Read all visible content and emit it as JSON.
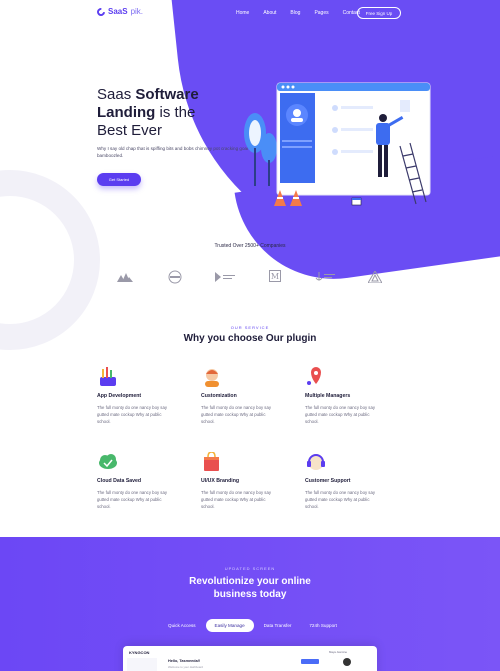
{
  "brand": {
    "name_bold": "SaaS",
    "name_light": "pik."
  },
  "nav": {
    "items": [
      "Home",
      "About",
      "Blog",
      "Pages",
      "Contact"
    ],
    "signup_label": "Free Sign Up"
  },
  "hero": {
    "title_1": "Saas ",
    "title_bold_1": "Software",
    "title_bold_2": "Landing",
    "title_2": " is the",
    "title_3": "Best Ever",
    "subtitle": "Why I say old chap that is spiffing bits and bobs chimney pot cracking goal bamboozled.",
    "cta_label": "Get Started"
  },
  "trusted": {
    "title": "Trusted Over 2500+ Companies",
    "logos": [
      "mountain-logo",
      "badge-logo",
      "creative-media-logo",
      "m-logo",
      "sea-time-logo",
      "nova-logo"
    ]
  },
  "services": {
    "kicker": "OUR SERVICE",
    "title": "Why you choose Our plugin",
    "items": [
      {
        "title": "App Development",
        "desc": "The full monty do one nancy boy say gutted mate cockup Why at public school.",
        "icon": "pencils-icon"
      },
      {
        "title": "Customization",
        "desc": "The full monty do one nancy boy say gutted mate cockup Why at public school.",
        "icon": "support-agent-icon"
      },
      {
        "title": "Multiple Managers",
        "desc": "The full monty do one nancy boy say gutted mate cockup Why at public school.",
        "icon": "map-pin-icon"
      },
      {
        "title": "Cloud Data Saved",
        "desc": "The full monty do one nancy boy say gutted mate cockup Why at public school.",
        "icon": "cloud-check-icon"
      },
      {
        "title": "UI/UX Branding",
        "desc": "The full monty do one nancy boy say gutted mate cockup Why at public school.",
        "icon": "shopping-bag-icon"
      },
      {
        "title": "Customer Support",
        "desc": "The full monty do one nancy boy say gutted mate cockup Why at public school.",
        "icon": "headset-icon"
      }
    ]
  },
  "updated": {
    "kicker": "UPDATED SCREEN",
    "title_1": "Revolutionize your online",
    "title_2": "business today",
    "tabs": [
      "Quick Access",
      "Easily Manage",
      "Data Transfer",
      "724h Support"
    ],
    "active_tab": "Easily Manage"
  },
  "dashboard": {
    "logo": "KYNGCON",
    "hello": "Hello, Tasmeeda!!",
    "sub": "Welcome to your dashboard",
    "user": "Maya Jasmine"
  },
  "colors": {
    "accent": "#5b3df0",
    "purple": "#6c47f5"
  }
}
